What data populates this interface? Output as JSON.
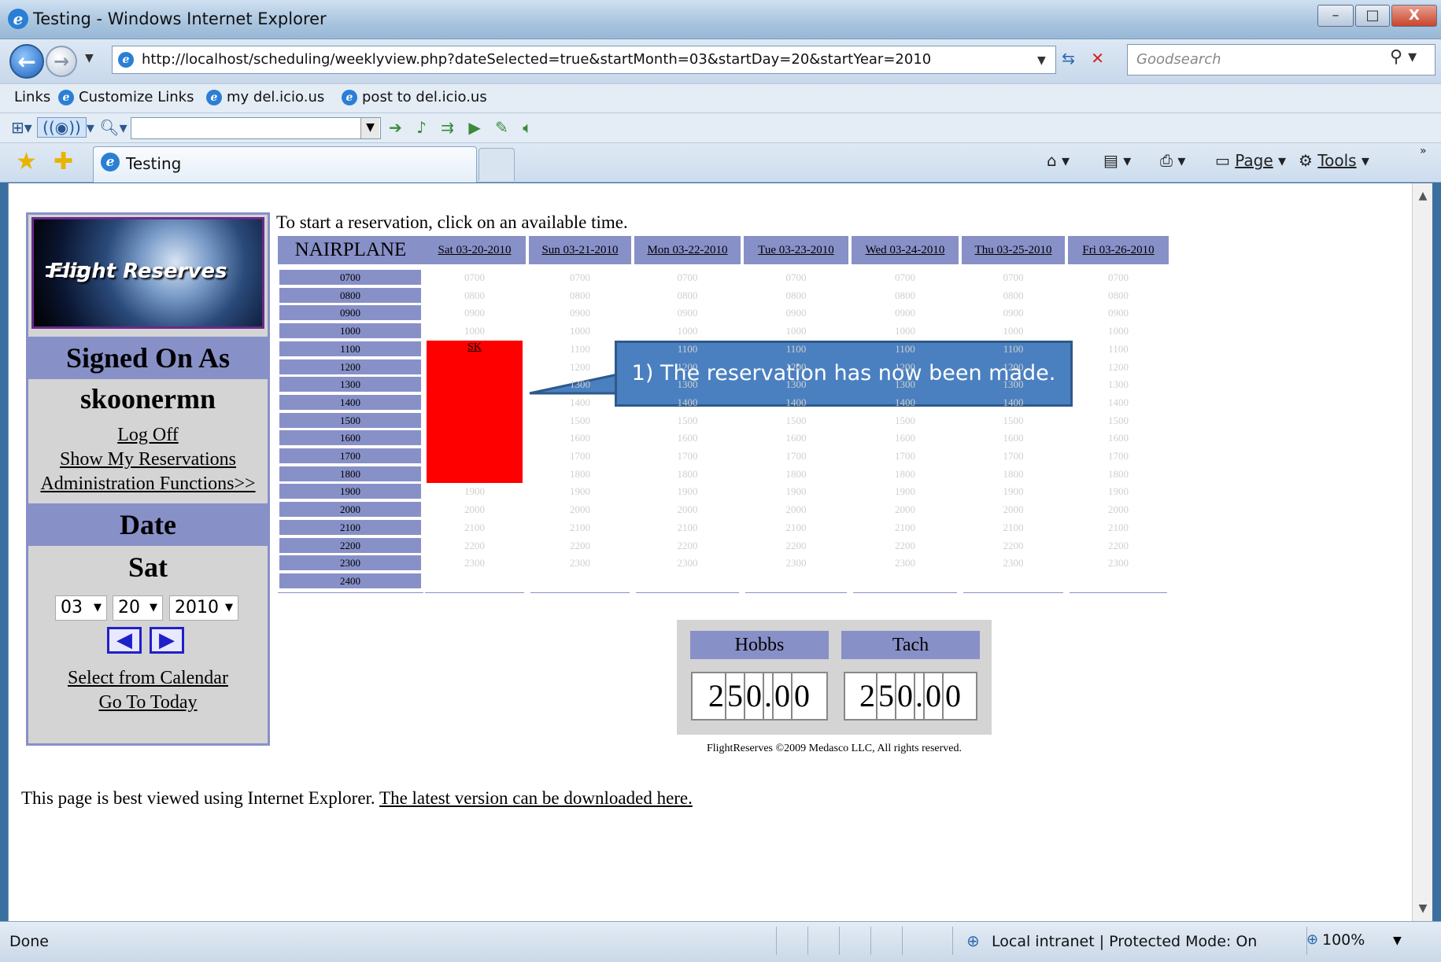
{
  "window": {
    "title": "Testing - Windows Internet Explorer",
    "min": "–",
    "max": "□",
    "close": "X"
  },
  "address_bar": {
    "url": "http://localhost/scheduling/weeklyview.php?dateSelected=true&startMonth=03&startDay=20&startYear=2010",
    "search_placeholder": "Goodsearch"
  },
  "links_bar": {
    "label": "Links",
    "items": [
      "Customize Links",
      "my del.icio.us",
      "post to del.icio.us"
    ]
  },
  "tab": {
    "label": "Testing"
  },
  "command_bar": {
    "page": "Page",
    "tools": "Tools"
  },
  "sidebar": {
    "logo_text": "Flight Reserves",
    "signed_on_heading": "Signed On As",
    "username": "skoonermn",
    "links": [
      "Log Off",
      "Show My Reservations",
      "Administration Functions>>"
    ],
    "date_heading": "Date",
    "day": "Sat",
    "month": "03",
    "date": "20",
    "year": "2010",
    "calendar_links": [
      "Select from Calendar",
      "Go To Today"
    ]
  },
  "schedule": {
    "instruction": "To start a reservation, click on an available time.",
    "aircraft": "NAIRPLANE",
    "days": [
      "Sat 03-20-2010",
      "Sun 03-21-2010",
      "Mon 03-22-2010",
      "Tue 03-23-2010",
      "Wed 03-24-2010",
      "Thu 03-25-2010",
      "Fri 03-26-2010"
    ],
    "hours": [
      "0700",
      "0800",
      "0900",
      "1000",
      "1100",
      "1200",
      "1300",
      "1400",
      "1500",
      "1600",
      "1700",
      "1800",
      "1900",
      "2000",
      "2100",
      "2200",
      "2300",
      "2400"
    ],
    "reservation": {
      "day": "Sat 03-20-2010",
      "start": "1100",
      "end": "1800",
      "label": "SK",
      "color": "#ff0000"
    }
  },
  "callout": {
    "text": "1) The reservation has now been made."
  },
  "meters": {
    "hobbs_label": "Hobbs",
    "tach_label": "Tach",
    "hobbs_value": "250.00",
    "tach_value": "250.00"
  },
  "copyright": "FlightReserves ©2009 Medasco LLC, All rights reserved.",
  "footer_note": {
    "text": "This page is best viewed using Internet Explorer.",
    "link": "The latest version can be downloaded here."
  },
  "status_bar": {
    "status": "Done",
    "zone": "Local intranet | Protected Mode: On",
    "zoom": "100%"
  },
  "colors": {
    "header_band": "#8890c8",
    "reservation": "#ff0000",
    "callout": "#4a80c0"
  }
}
